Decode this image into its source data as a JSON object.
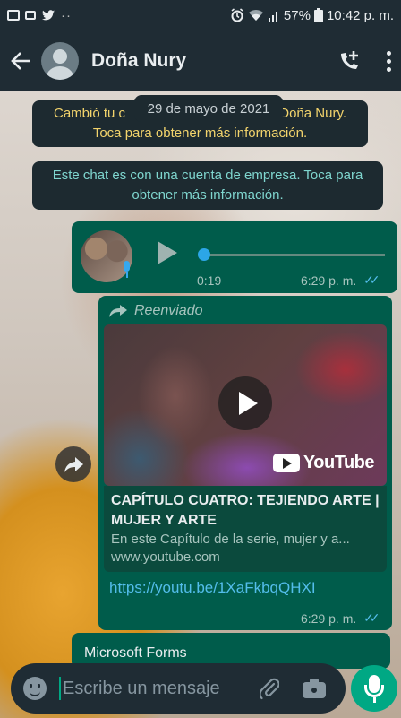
{
  "status_bar": {
    "battery": "57%",
    "time": "10:42 p. m."
  },
  "header": {
    "contact_name": "Doña Nury",
    "back_icon": "arrow-left-icon",
    "call_icon": "add-call-icon",
    "menu_icon": "more-vertical-icon"
  },
  "chat": {
    "date_pill": "29 de mayo de 2021",
    "system_messages": [
      {
        "line1": "Cambió tu c",
        "line1_end": "n Doña Nury.",
        "line2": "Toca para obtener más información."
      },
      {
        "text": "Este chat es con una cuenta de empresa. Toca para obtener más información."
      }
    ],
    "voice_message": {
      "duration": "0:19",
      "time": "6:29 p. m.",
      "read_ticks": "✓✓"
    },
    "forwarded_message": {
      "forwarded_label": "Reenviado",
      "video_brand": "YouTube",
      "preview_title": "CAPÍTULO CUATRO: TEJIENDO ARTE | MUJER Y ARTE",
      "preview_description": "En este Capítulo de la serie, mujer y a...",
      "preview_domain": "www.youtube.com",
      "link": "https://youtu.be/1XaFkbqQHXI",
      "time": "6:29 p. m.",
      "read_ticks": "✓✓"
    },
    "partial_message": {
      "text": "Microsoft Forms"
    }
  },
  "composer": {
    "placeholder": "Escribe un mensaje"
  },
  "colors": {
    "header_bg": "#1f2c34",
    "outgoing_bubble": "#005c4b",
    "accent": "#00a884",
    "link": "#53bdeb",
    "system_text": "#f3d46c"
  }
}
